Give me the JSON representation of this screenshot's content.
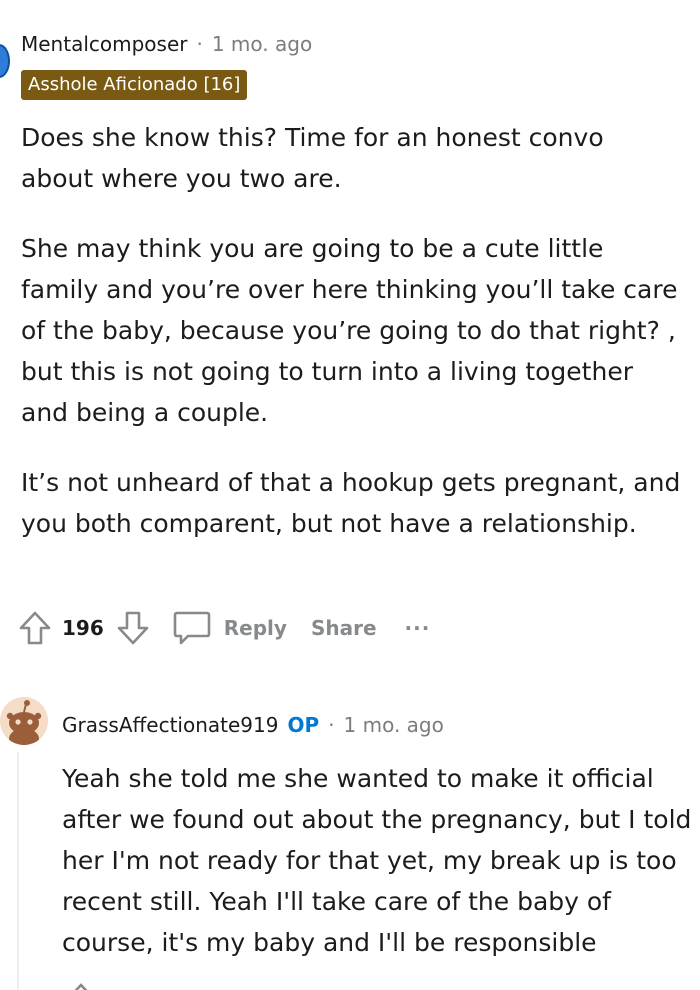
{
  "comment1": {
    "username": "Mentalcomposer",
    "separator": "·",
    "timestamp": "1 mo. ago",
    "flair": "Asshole Aficionado [16]",
    "paragraphs": [
      "Does she know this? Time for an honest convo about where you two are.",
      "She may think you are going to be a cute little family and you’re over here thinking you’ll take care of the baby, because you’re going to do that right? , but this is not going to turn into a living together and being a couple.",
      "It’s not unheard of that a hookup gets pregnant, and you both comparent, but not have a relationship."
    ],
    "actions": {
      "score": "196",
      "reply": "Reply",
      "share": "Share",
      "more": "···"
    }
  },
  "comment2": {
    "username": "GrassAffectionate919",
    "op_badge": "OP",
    "separator": "·",
    "timestamp": "1 mo. ago",
    "paragraphs": [
      "Yeah she told me she wanted to make it official after we found out about the pregnancy, but I told her I'm not ready for that yet, my break up is too recent still. Yeah I'll take care of the baby of course, it's my baby and I'll be responsible"
    ]
  },
  "icons": {
    "upvote": "upvote-arrow-icon",
    "downvote": "downvote-arrow-icon",
    "reply": "speech-bubble-icon",
    "avatar": "snoo-avatar-icon"
  },
  "colors": {
    "flair_bg": "#7a5a13",
    "op": "#0079d3",
    "meta": "#7c7c7c",
    "action": "#878a8c"
  }
}
